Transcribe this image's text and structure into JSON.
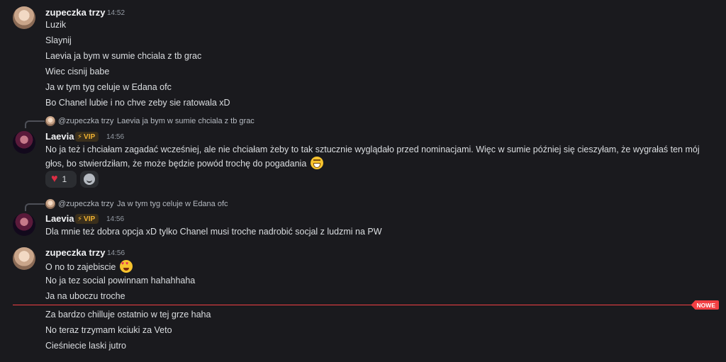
{
  "groups": [
    {
      "author": "zupeczka trzy",
      "time": "14:52",
      "messages": [
        "Luzik",
        "Slaynij",
        "Laevia ja bym w sumie chciala z tb grac",
        "Wiec cisnij babe",
        "Ja w tym tyg celuje w Edana ofc",
        "Bo Chanel lubie i no chve zeby sie ratowala xD"
      ]
    },
    {
      "reply_to": {
        "name": "@zupeczka trzy",
        "text": "Laevia ja bym w sumie chciala z tb grac"
      },
      "author": "Laevia",
      "badge": "VIP",
      "time": "14:56",
      "message": "No ja też i chciałam zagadać wcześniej, ale nie chciałam żeby to tak sztucznie wyglądało przed nominacjami. Więc w sumie później się cieszyłam, że wygrałaś ten mój głos, bo stwierdziłam, że może będzie powód trochę do pogadania",
      "emoji": "grinning-face",
      "reaction": {
        "emoji": "heart",
        "count": "1"
      }
    },
    {
      "reply_to": {
        "name": "@zupeczka trzy",
        "text": "Ja w tym tyg celuje w Edana ofc"
      },
      "author": "Laevia",
      "badge": "VIP",
      "time": "14:56",
      "message": "Dla mnie też dobra opcja xD tylko Chanel musi troche nadrobić socjal z ludzmi na PW"
    },
    {
      "author": "zupeczka trzy",
      "time": "14:56",
      "messages": [
        "O no to zajebiscie",
        "No ja tez social powinnam hahahhaha",
        "Ja na uboczu troche"
      ],
      "emoji": "heart-eyes"
    }
  ],
  "new_divider": "NOWE",
  "after_divider": [
    "Za bardzo chilluje ostatnio w tej grze haha",
    "No teraz trzymam kciuki za Veto",
    "Cieśniecie laski jutro"
  ]
}
